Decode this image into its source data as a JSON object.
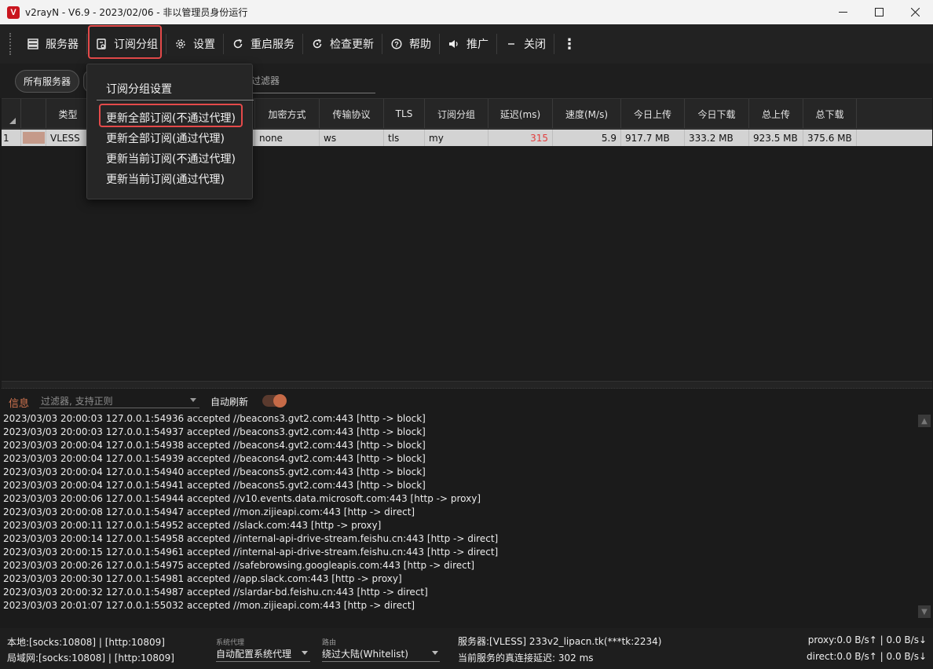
{
  "window": {
    "title": "v2rayN - V6.9 - 2023/02/06 - 非以管理员身份运行",
    "logo": "V"
  },
  "toolbar": {
    "servers": "服务器",
    "subscription_group": "订阅分组",
    "settings": "设置",
    "restart_service": "重启服务",
    "check_update": "检查更新",
    "help": "帮助",
    "promotion": "推广",
    "close": "关闭"
  },
  "groupbar": {
    "all_servers": "所有服务器",
    "filter_label": "过滤器"
  },
  "menu": {
    "items": [
      "订阅分组设置",
      "更新全部订阅(不通过代理)",
      "更新全部订阅(通过代理)",
      "更新当前订阅(不通过代理)",
      "更新当前订阅(通过代理)"
    ]
  },
  "grid": {
    "columns": [
      "类型",
      "",
      "",
      "加密方式",
      "传输协议",
      "TLS",
      "订阅分组",
      "延迟(ms)",
      "速度(M/s)",
      "今日上传",
      "今日下载",
      "总上传",
      "总下载"
    ],
    "rows": [
      {
        "index": "1",
        "type": "VLESS",
        "security": "none",
        "network": "ws",
        "tls": "tls",
        "group": "my",
        "latency": "315",
        "speed": "5.9",
        "today_up": "917.7 MB",
        "today_down": "333.2 MB",
        "total_up": "923.5 MB",
        "total_down": "375.6 MB"
      }
    ]
  },
  "log": {
    "tab": "信息",
    "filter_placeholder": "过滤器, 支持正则",
    "auto_refresh": "自动刷新",
    "lines": [
      "2023/03/03 20:00:03 127.0.0.1:54936 accepted //beacons3.gvt2.com:443 [http -> block]",
      "2023/03/03 20:00:03 127.0.0.1:54937 accepted //beacons3.gvt2.com:443 [http -> block]",
      "2023/03/03 20:00:04 127.0.0.1:54938 accepted //beacons4.gvt2.com:443 [http -> block]",
      "2023/03/03 20:00:04 127.0.0.1:54939 accepted //beacons4.gvt2.com:443 [http -> block]",
      "2023/03/03 20:00:04 127.0.0.1:54940 accepted //beacons5.gvt2.com:443 [http -> block]",
      "2023/03/03 20:00:04 127.0.0.1:54941 accepted //beacons5.gvt2.com:443 [http -> block]",
      "2023/03/03 20:00:06 127.0.0.1:54944 accepted //v10.events.data.microsoft.com:443 [http -> proxy]",
      "2023/03/03 20:00:08 127.0.0.1:54947 accepted //mon.zijieapi.com:443 [http -> direct]",
      "2023/03/03 20:00:11 127.0.0.1:54952 accepted //slack.com:443 [http -> proxy]",
      "2023/03/03 20:00:14 127.0.0.1:54958 accepted //internal-api-drive-stream.feishu.cn:443 [http -> direct]",
      "2023/03/03 20:00:15 127.0.0.1:54961 accepted //internal-api-drive-stream.feishu.cn:443 [http -> direct]",
      "2023/03/03 20:00:26 127.0.0.1:54975 accepted //safebrowsing.googleapis.com:443 [http -> direct]",
      "2023/03/03 20:00:30 127.0.0.1:54981 accepted //app.slack.com:443 [http -> proxy]",
      "2023/03/03 20:00:32 127.0.0.1:54987 accepted //slardar-bd.feishu.cn:443 [http -> direct]",
      "2023/03/03 20:01:07 127.0.0.1:55032 accepted //mon.zijieapi.com:443 [http -> direct]"
    ]
  },
  "status": {
    "local": "本地:[socks:10808] | [http:10809]",
    "lan": "局域网:[socks:10808] | [http:10809]",
    "sysproxy_label": "系统代理",
    "sysproxy_value": "自动配置系统代理",
    "routing_label": "路由",
    "routing_value": "绕过大陆(Whitelist)",
    "server": "服务器:[VLESS] 233v2_lipacn.tk(***tk:2234)",
    "delay": "当前服务的真连接延迟: 302 ms",
    "proxy_speed": "proxy:0.0 B/s↑ | 0.0 B/s↓",
    "direct_speed": "direct:0.0 B/s↑ | 0.0 B/s↓"
  },
  "colors": {
    "highlight": "#e44a4a",
    "accent": "#d2744f",
    "latency": "#e23c3c"
  }
}
